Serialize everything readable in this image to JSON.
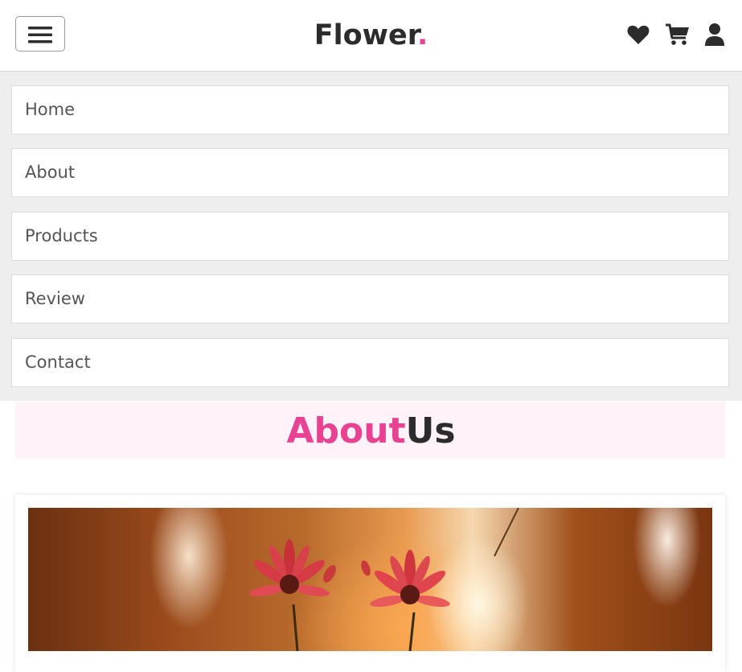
{
  "header": {
    "logo_text": "Flower",
    "logo_dot": ".",
    "icons": [
      "menu-icon",
      "heart-icon",
      "cart-icon",
      "user-icon"
    ]
  },
  "nav": {
    "items": [
      "Home",
      "About",
      "Products",
      "Review",
      "Contact"
    ]
  },
  "about": {
    "title_highlight": "About",
    "title_rest": "Us"
  },
  "colors": {
    "accent": "#e84393",
    "text_dark": "#2c2c2c",
    "nav_bg": "#eeeeee",
    "about_band_bg": "#fff3f9"
  }
}
